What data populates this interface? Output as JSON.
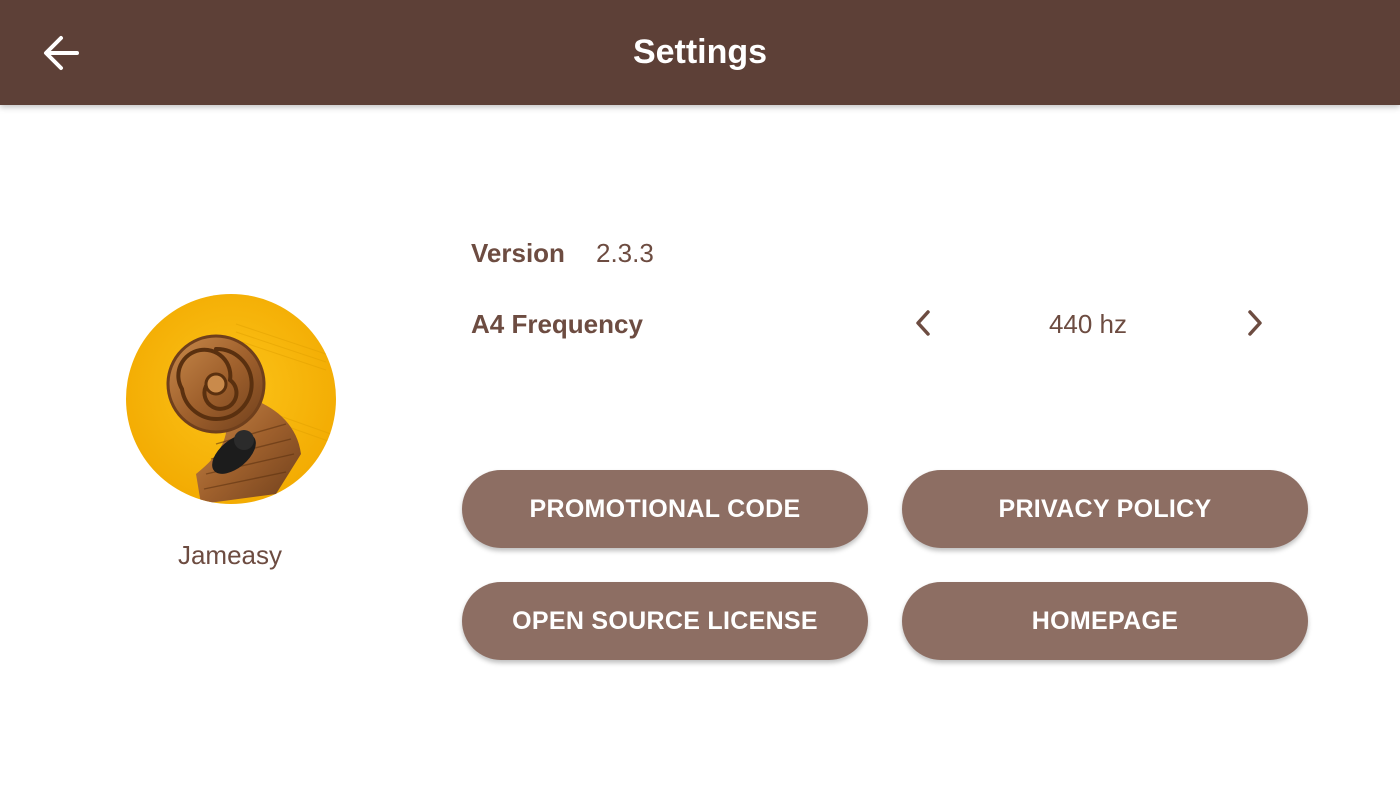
{
  "header": {
    "title": "Settings",
    "back_icon": "arrow-left-icon",
    "background_color": "#5d4037"
  },
  "app": {
    "name": "Jameasy",
    "logo_icon": "violin-scroll-logo"
  },
  "info": {
    "version_label": "Version",
    "version_value": "2.3.3",
    "frequency_label": "A4 Frequency",
    "frequency_value": "440 hz",
    "prev_icon": "chevron-left-icon",
    "next_icon": "chevron-right-icon"
  },
  "buttons": {
    "promotional_code": "PROMOTIONAL CODE",
    "privacy_policy": "PRIVACY POLICY",
    "open_source_license": "OPEN SOURCE LICENSE",
    "homepage": "HOMEPAGE",
    "color": "#8d6e63"
  },
  "colors": {
    "text_brown": "#6d4c41",
    "logo_yellow": "#f5b800"
  }
}
